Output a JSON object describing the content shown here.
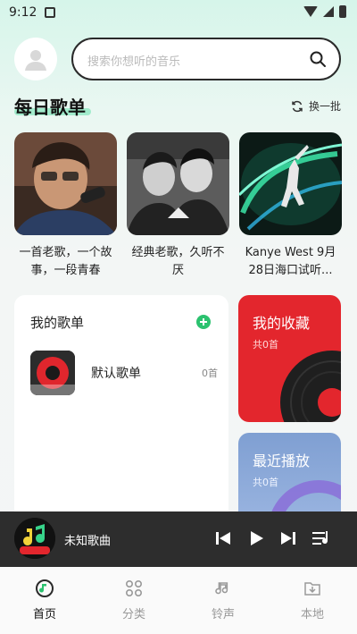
{
  "status": {
    "time": "9:12"
  },
  "search": {
    "placeholder": "搜索你想听的音乐"
  },
  "daily": {
    "title": "每日歌单",
    "refresh_label": "换一批",
    "cards": [
      {
        "caption": "一首老歌，一个故事，一段青春"
      },
      {
        "caption": "经典老歌，久听不厌"
      },
      {
        "caption": "Kanye West 9月28日海口试听..."
      }
    ]
  },
  "my_playlists": {
    "title": "我的歌单",
    "items": [
      {
        "name": "默认歌单",
        "count": "0首"
      }
    ]
  },
  "favorites": {
    "title": "我的收藏",
    "count": "共0首"
  },
  "recent": {
    "title": "最近播放",
    "count": "共0首"
  },
  "player": {
    "song": "未知歌曲",
    "cover_text": "免费音乐"
  },
  "tabs": [
    {
      "label": "首页",
      "icon": "music-note-icon"
    },
    {
      "label": "分类",
      "icon": "grid-icon"
    },
    {
      "label": "铃声",
      "icon": "bell-music-icon"
    },
    {
      "label": "本地",
      "icon": "download-folder-icon"
    }
  ],
  "colors": {
    "accent": "#2bc26f",
    "favorite": "#e3262d",
    "recent": "#8fabdc",
    "player_bg": "#2d2d2d"
  }
}
